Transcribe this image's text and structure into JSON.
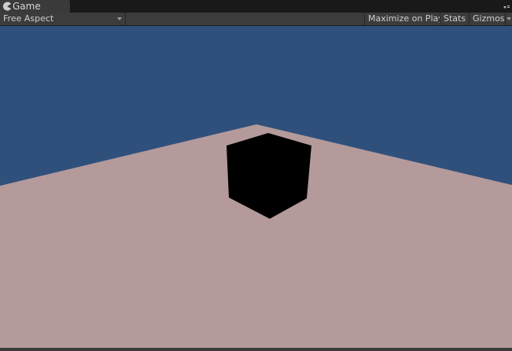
{
  "tab": {
    "title": "Game",
    "icon": "pacman-icon"
  },
  "toolbar": {
    "aspect": "Free Aspect",
    "maximize_label": "Maximize on Play",
    "stats_label": "Stats",
    "gizmos_label": "Gizmos"
  },
  "scene": {
    "sky_color": "#30507c",
    "ground_color": "#b49a9b",
    "cube_color": "#000000"
  }
}
